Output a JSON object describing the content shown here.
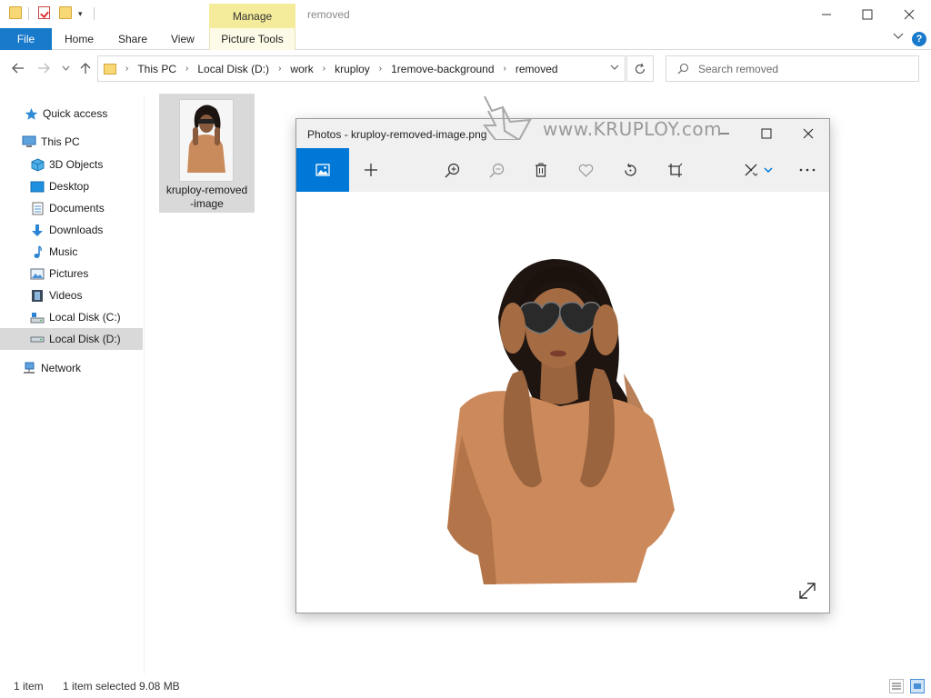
{
  "window": {
    "title": "removed",
    "contextual_tab": "Manage",
    "controls": {
      "minimize": "—",
      "maximize": "☐",
      "close": "✕"
    }
  },
  "ribbon": {
    "tabs": [
      "File",
      "Home",
      "Share",
      "View",
      "Picture Tools"
    ],
    "accent": "#1979ca",
    "manage_color": "#f5ec9b"
  },
  "address": {
    "path": [
      "This PC",
      "Local Disk (D:)",
      "work",
      "kruploy",
      "1remove-background",
      "removed"
    ]
  },
  "search": {
    "placeholder": "Search removed"
  },
  "sidebar": {
    "items": [
      {
        "label": "Quick access",
        "icon": "star-icon"
      },
      {
        "label": "This PC",
        "icon": "computer-icon"
      },
      {
        "label": "3D Objects",
        "icon": "cube-icon"
      },
      {
        "label": "Desktop",
        "icon": "desktop-icon"
      },
      {
        "label": "Documents",
        "icon": "document-icon"
      },
      {
        "label": "Downloads",
        "icon": "download-icon"
      },
      {
        "label": "Music",
        "icon": "music-icon"
      },
      {
        "label": "Pictures",
        "icon": "picture-icon"
      },
      {
        "label": "Videos",
        "icon": "video-icon"
      },
      {
        "label": "Local Disk (C:)",
        "icon": "drive-icon"
      },
      {
        "label": "Local Disk (D:)",
        "icon": "drive-icon",
        "selected": true
      },
      {
        "label": "Network",
        "icon": "network-icon"
      }
    ]
  },
  "files": [
    {
      "name_line1": "kruploy-removed",
      "name_line2": "-image",
      "selected": true
    }
  ],
  "status": {
    "count": "1 item",
    "selection": "1 item selected",
    "size": "9.08 MB"
  },
  "photos": {
    "title": "Photos - kruploy-removed-image.png",
    "toolbar": [
      "view-image",
      "add",
      "zoom-in",
      "zoom-out",
      "delete",
      "favorite",
      "rotate",
      "crop",
      "edit",
      "more"
    ]
  },
  "watermark": {
    "text": "www.KRUPLOY.com"
  }
}
